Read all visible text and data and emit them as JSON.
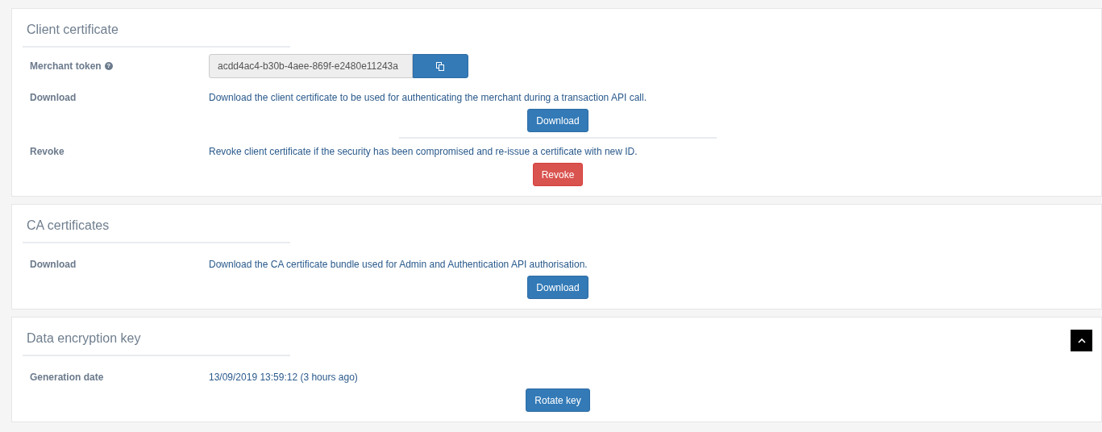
{
  "sections": [
    {
      "title": "Client certificate",
      "rows": [
        {
          "kind": "token",
          "label": "Merchant token",
          "help": "?",
          "value": "acdd4ac4-b30b-4aee-869f-e2480e11243a"
        },
        {
          "kind": "action",
          "label": "Download",
          "text": "Download the client certificate to be used for authenticating the merchant during a transaction API call.",
          "button": {
            "label": "Download",
            "kind": "primary"
          }
        },
        {
          "kind": "action",
          "label": "Revoke",
          "text": "Revoke client certificate if the security has been compromised and re-issue a certificate with new ID.",
          "button": {
            "label": "Revoke",
            "kind": "danger"
          }
        }
      ]
    },
    {
      "title": "CA certificates",
      "rows": [
        {
          "kind": "action",
          "label": "Download",
          "text": "Download the CA certificate bundle used for Admin and Authentication API authorisation.",
          "button": {
            "label": "Download",
            "kind": "primary"
          }
        }
      ]
    },
    {
      "title": "Data encryption key",
      "rows": [
        {
          "kind": "action",
          "label": "Generation date",
          "text": "13/09/2019 13:59:12 (3 hours ago)",
          "button": {
            "label": "Rotate key",
            "kind": "primary"
          }
        }
      ]
    }
  ]
}
